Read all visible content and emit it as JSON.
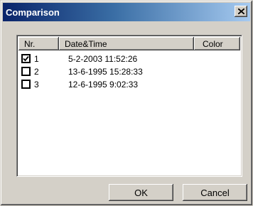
{
  "window": {
    "title": "Comparison"
  },
  "list": {
    "columns": {
      "nr": "Nr.",
      "datetime": "Date&Time",
      "color": "Color"
    },
    "rows": [
      {
        "nr": "1",
        "datetime": "5-2-2003 11:52:26",
        "checked": true
      },
      {
        "nr": "2",
        "datetime": "13-6-1995 15:28:33",
        "checked": false
      },
      {
        "nr": "3",
        "datetime": "12-6-1995 9:02:33",
        "checked": false
      }
    ]
  },
  "buttons": {
    "ok": "OK",
    "cancel": "Cancel"
  }
}
